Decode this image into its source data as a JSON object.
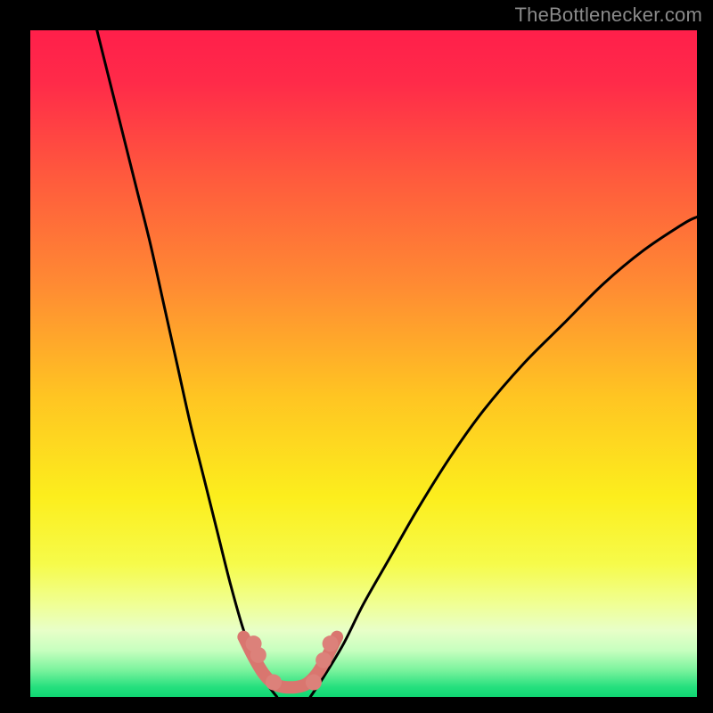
{
  "watermark": {
    "text": "TheBottlenecker.com"
  },
  "chart_data": {
    "type": "line",
    "title": "",
    "xlabel": "",
    "ylabel": "",
    "xlim": [
      0,
      100
    ],
    "ylim": [
      0,
      100
    ],
    "series": [
      {
        "name": "curve-left",
        "x": [
          10,
          12,
          14,
          16,
          18,
          20,
          22,
          24,
          26,
          28,
          30,
          32,
          34,
          35.5,
          37
        ],
        "y": [
          100,
          92,
          84,
          76,
          68,
          59,
          50,
          41,
          33,
          25,
          17,
          10,
          5,
          2,
          0
        ]
      },
      {
        "name": "curve-right",
        "x": [
          42,
          44,
          47,
          50,
          54,
          58,
          63,
          68,
          74,
          80,
          86,
          92,
          98,
          100
        ],
        "y": [
          0,
          3,
          8,
          14,
          21,
          28,
          36,
          43,
          50,
          56,
          62,
          67,
          71,
          72
        ]
      },
      {
        "name": "trough-segment",
        "x": [
          32,
          33.5,
          35,
          36.5,
          38,
          40,
          41.5,
          43,
          44.5,
          46
        ],
        "y": [
          9,
          6,
          3.5,
          2,
          1.5,
          1.5,
          2,
          3.5,
          6,
          9
        ]
      }
    ],
    "markers": {
      "name": "trough-dots",
      "x": [
        33.5,
        34.2,
        36.5,
        42.5,
        44,
        45
      ],
      "y": [
        8,
        6.3,
        2.2,
        2.2,
        5.5,
        8
      ]
    },
    "gradient_stops": [
      {
        "offset": 0.0,
        "color": "#ff1f4a"
      },
      {
        "offset": 0.08,
        "color": "#ff2b49"
      },
      {
        "offset": 0.22,
        "color": "#ff5a3d"
      },
      {
        "offset": 0.38,
        "color": "#ff8a33"
      },
      {
        "offset": 0.55,
        "color": "#ffc522"
      },
      {
        "offset": 0.7,
        "color": "#fcee1d"
      },
      {
        "offset": 0.8,
        "color": "#f6fb4a"
      },
      {
        "offset": 0.86,
        "color": "#f0ff93"
      },
      {
        "offset": 0.9,
        "color": "#e8ffc8"
      },
      {
        "offset": 0.93,
        "color": "#c7ffbf"
      },
      {
        "offset": 0.96,
        "color": "#7af39d"
      },
      {
        "offset": 0.985,
        "color": "#26e07e"
      },
      {
        "offset": 1.0,
        "color": "#0fd672"
      }
    ],
    "colors": {
      "curve": "#000000",
      "trough_stroke": "#d9766f",
      "trough_fill": "#d9766f",
      "marker_fill": "#dc817a"
    }
  }
}
